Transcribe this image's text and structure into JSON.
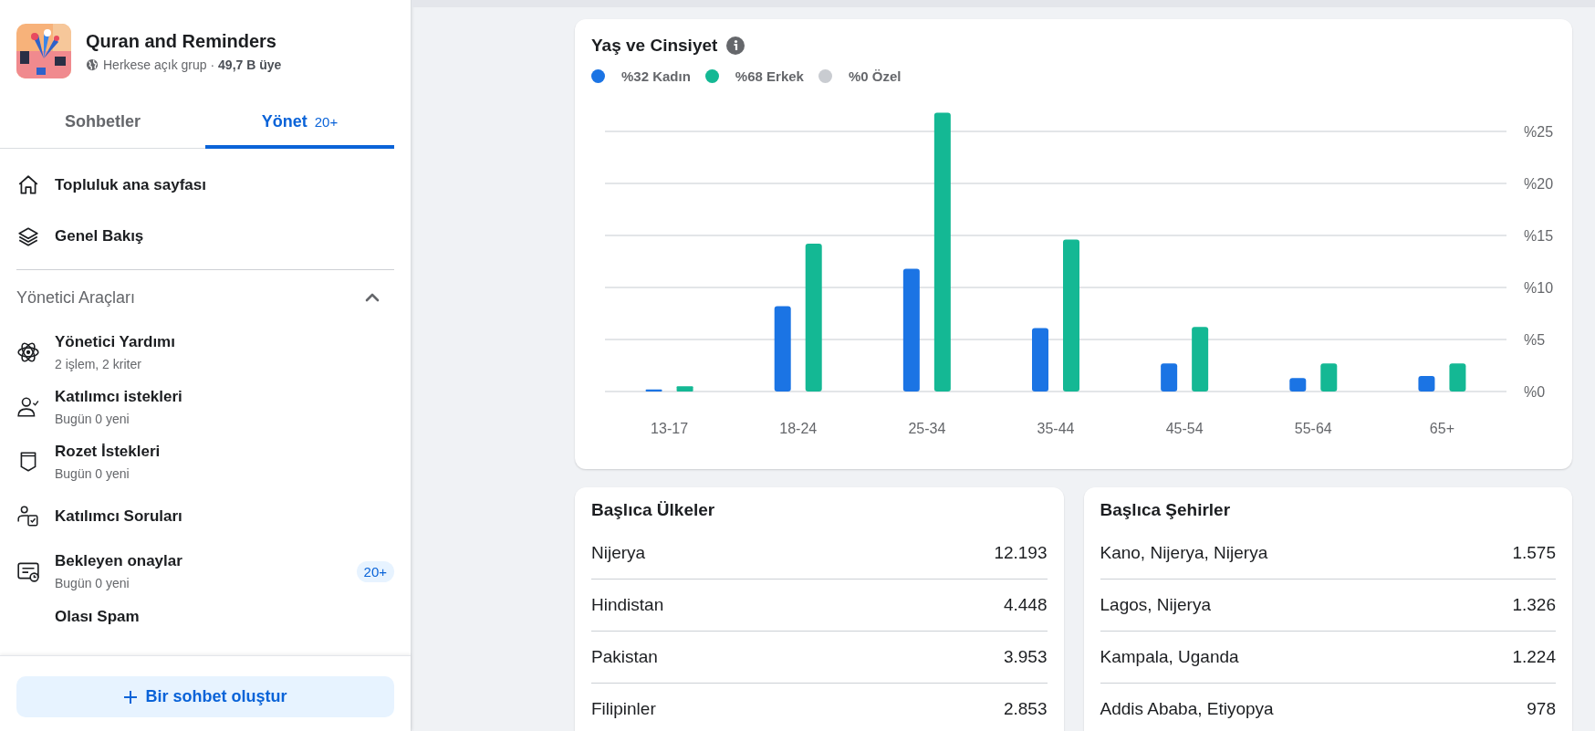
{
  "group": {
    "name": "Quran and Reminders",
    "meta": "Herkese açık grup · **49,7 B üye**"
  },
  "tabs": [
    {
      "label": "Sohbetler",
      "selected": false
    },
    {
      "label": "Yönet",
      "badge": "20+",
      "selected": true
    }
  ],
  "nav": [
    {
      "label": "Topluluk ana sayfası"
    },
    {
      "label": "Genel Bakış"
    }
  ],
  "admin_tools": {
    "title": "Yönetici Araçları",
    "expanded": true,
    "items": [
      {
        "label": "Yönetici Yardımı",
        "subtitle": "2 işlem, 2 kriter"
      },
      {
        "label": "Katılımcı istekleri",
        "subtitle": "Bugün 0 yeni"
      },
      {
        "label": "Rozet İstekleri",
        "subtitle": "Bugün 0 yeni"
      },
      {
        "label": "Katılımcı Soruları"
      },
      {
        "label": "Bekleyen onaylar",
        "subtitle": "Bugün 0 yeni",
        "badge": "20+"
      },
      {
        "label": "Olası Spam"
      }
    ]
  },
  "create_button": {
    "label": "Bir sohbet oluştur"
  },
  "age_gender": {
    "title": "Yaş ve Cinsiyet",
    "legend": [
      {
        "label": "%32 Kadın",
        "color": "#1b74e4"
      },
      {
        "label": "%68 Erkek",
        "color": "#14b894"
      },
      {
        "label": "%0 Özel",
        "color": "#c9ccd1"
      }
    ],
    "chart_data": {
      "type": "bar",
      "categories": [
        "13-17",
        "18-24",
        "25-34",
        "35-44",
        "45-54",
        "55-64",
        "65+"
      ],
      "series": [
        {
          "color": "#1b74e4",
          "values": [
            0.2,
            8.2,
            11.8,
            6.1,
            2.7,
            1.3,
            1.5
          ]
        },
        {
          "color": "#14b894",
          "values": [
            0.5,
            14.2,
            26.8,
            14.6,
            6.2,
            2.7,
            2.7
          ]
        }
      ],
      "ylim": [
        0,
        27
      ],
      "grid": true,
      "yticks": [
        {
          "value": 0,
          "label": "%0"
        },
        {
          "value": 5,
          "label": "%5"
        },
        {
          "value": 10,
          "label": "%10"
        },
        {
          "value": 15,
          "label": "%15"
        },
        {
          "value": 20,
          "label": "%20"
        },
        {
          "value": 25,
          "label": "%25"
        }
      ]
    }
  },
  "top_countries": {
    "title": "Başlıca Ülkeler",
    "rows": [
      {
        "name": "Nijerya",
        "value": "12.193"
      },
      {
        "name": "Hindistan",
        "value": "4.448"
      },
      {
        "name": "Pakistan",
        "value": "3.953"
      },
      {
        "name": "Filipinler",
        "value": "2.853"
      }
    ]
  },
  "top_cities": {
    "title": "Başlıca Şehirler",
    "rows": [
      {
        "name": "Kano, Nijerya, Nijerya",
        "value": "1.575"
      },
      {
        "name": "Lagos, Nijerya",
        "value": "1.326"
      },
      {
        "name": "Kampala, Uganda",
        "value": "1.224"
      },
      {
        "name": "Addis Ababa, Etiyopya",
        "value": "978"
      }
    ]
  }
}
